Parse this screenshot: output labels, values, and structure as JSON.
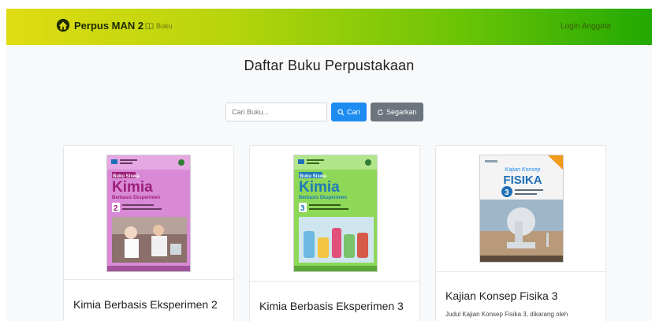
{
  "navbar": {
    "brand": "Perpus MAN 2",
    "link_buku": "Buku",
    "login": "Login Anggota"
  },
  "page_title": "Daftar Buku Perpustakaan",
  "search": {
    "placeholder": "Cari Buku...",
    "cari_label": "Cari",
    "segarkan_label": "Segarkan"
  },
  "books": [
    {
      "title": "Kimia Berbasis Eksperimen 2",
      "cover": {
        "series": "Buku Siswa",
        "subject": "Kimia",
        "subtitle": "Berbasis Eksperimen",
        "volume": "2",
        "color": "#d98ad6"
      }
    },
    {
      "title": "Kimia Berbasis Eksperimen 3",
      "cover": {
        "series": "Buku Siswa",
        "subject": "Kimia",
        "subtitle": "Berbasis Eksperimen",
        "volume": "3",
        "color": "#8ed858"
      }
    },
    {
      "title": "Kajian Konsep Fisika 3",
      "description": "Judul Kajian Konsep Fisika 3, dikarang oleh",
      "cover": {
        "series": "Kajian Konsep",
        "subject": "FISIKA",
        "volume": "3",
        "color": "#f4f4f4"
      }
    }
  ],
  "colors": {
    "navbar_start": "#e0dc12",
    "navbar_end": "#22a902",
    "primary": "#1e8bf0",
    "secondary": "#6c757d"
  }
}
